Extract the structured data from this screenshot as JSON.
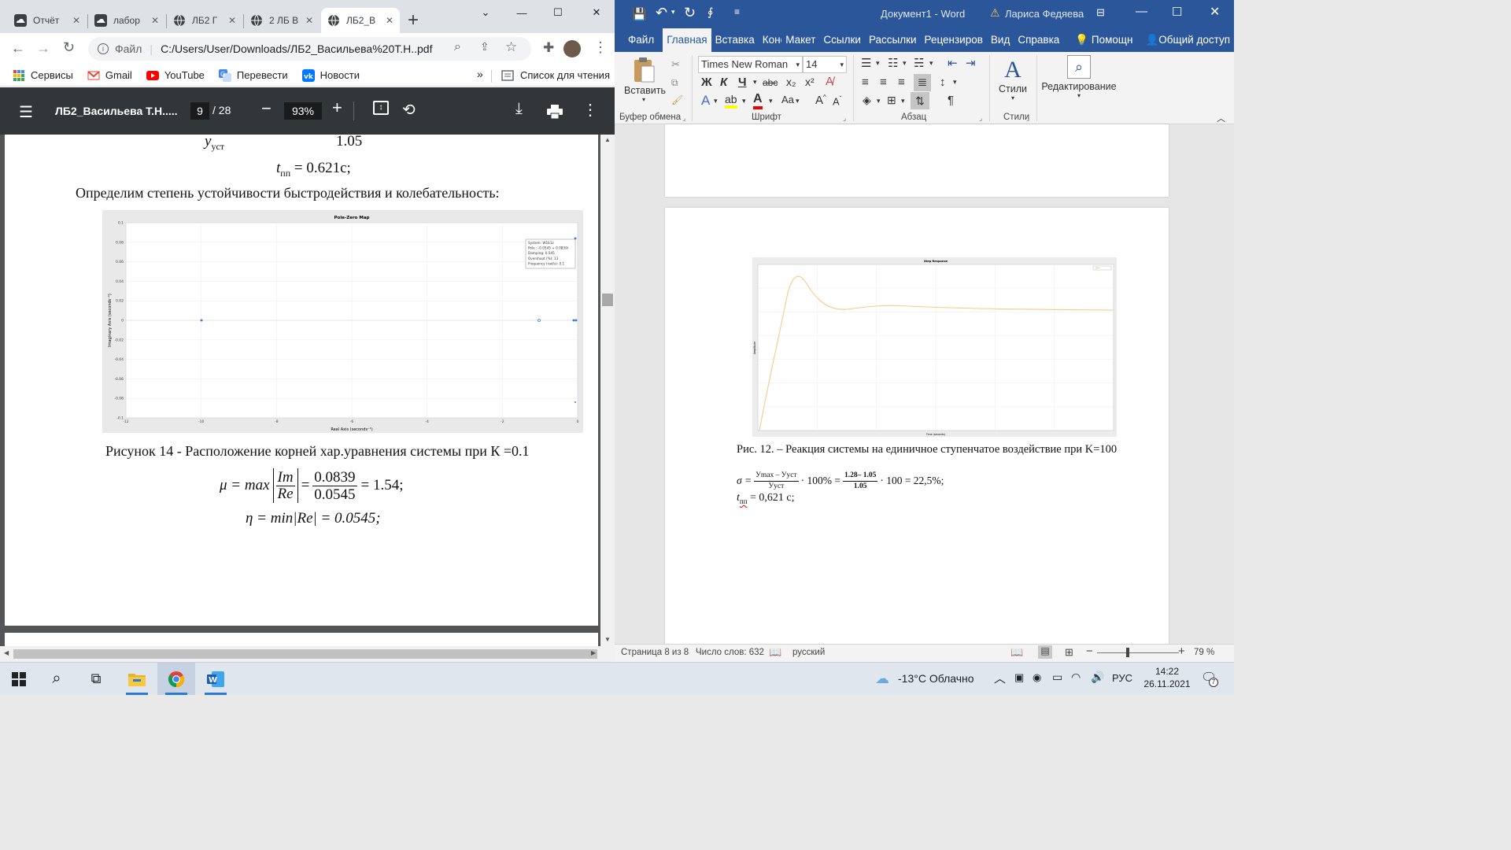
{
  "chrome": {
    "tabs": [
      {
        "label": "Отчёт"
      },
      {
        "label": "лабор"
      },
      {
        "label": "ЛБ2 Г"
      },
      {
        "label": "2 ЛБ В"
      },
      {
        "label": "ЛБ2_В"
      }
    ],
    "new_tab": "+",
    "address": {
      "scheme": "Файл",
      "url": "C:/Users/User/Downloads/ЛБ2_Васильева%20Т.Н..pdf"
    },
    "bookmarks": [
      {
        "label": "Сервисы",
        "icon": "apps-icon"
      },
      {
        "label": "Gmail",
        "icon": "gmail-icon"
      },
      {
        "label": "YouTube",
        "icon": "youtube-icon"
      },
      {
        "label": "Перевести",
        "icon": "translate-icon"
      },
      {
        "label": "Новости",
        "icon": "vk-icon"
      }
    ],
    "bookmarks_more": "»",
    "reading_list": "Список для чтения"
  },
  "pdf": {
    "title": "ЛБ2_Васильева Т.Н.....",
    "page_current": "9",
    "page_total": "/ 28",
    "zoom": "93%",
    "content": {
      "partial_line_sub": "уст",
      "partial_line_y": "y",
      "partial_value": "1.05",
      "t_pp": "= 0.621с;",
      "t_label": "t",
      "t_sub": "пп",
      "paragraph": "Определим степень устойчивости быстродействия и колебательность:",
      "figure_caption": "Рисунок 14 - Расположение корней хар.уравнения системы при К =0.1",
      "mu_lhs": "μ = max",
      "mu_im": "Im",
      "mu_re": "Re",
      "mu_num": "0.0839",
      "mu_den": "0.0545",
      "mu_result": "= 1.54;",
      "eta": "η = min|Re| = 0.0545;"
    }
  },
  "pole_zero_plot": {
    "title": "Pole-Zero Map",
    "xlabel": "Real Axis (seconds⁻¹)",
    "ylabel": "Imaginary Axis (seconds⁻¹)",
    "xticks": [
      "-12",
      "-10",
      "-8",
      "-6",
      "-4",
      "-2",
      "0"
    ],
    "yticks": [
      "0.1",
      "0.08",
      "0.06",
      "0.04",
      "0.02",
      "0",
      "-0.02",
      "-0.04",
      "-0.06",
      "-0.08",
      "-0.1"
    ],
    "tooltip": [
      "System: W1b1z",
      "Pole : -0.0545 + 0.0839i",
      "Damping: 0.545",
      "Overshoot (%): 13",
      "Frequency (rad/s): 0.1"
    ]
  },
  "word": {
    "title": "Документ1 - Word",
    "user": "Лариса Федяева",
    "tabs": [
      "Файл",
      "Главная",
      "Вставка",
      "Конструктор",
      "Макет",
      "Ссылки",
      "Рассылки",
      "Рецензиров",
      "Вид",
      "Справка"
    ],
    "help": "Помощн",
    "share": "Общий доступ",
    "ribbon": {
      "paste": "Вставить",
      "font_name": "Times New Roman",
      "font_size": "14",
      "styles": "Стили",
      "editing": "Редактирование",
      "groups": [
        "Буфер обмена",
        "Шрифт",
        "Абзац",
        "Стили"
      ],
      "bold": "Ж",
      "italic": "К",
      "underline": "Ч",
      "strike": "abc",
      "sub": "x₂",
      "sup": "x²",
      "case": "Aa",
      "grow": "A",
      "shrink": "A"
    },
    "step_plot": {
      "title": "Step Response",
      "xlabel": "Time (seconds)",
      "ylabel": "Amplitude"
    },
    "caption": "Рис. 12. – Реакция системы на единичное ступенчатое воздействие при K=100",
    "sigma": {
      "lhs": "σ =",
      "frac1_num": "Уmax – Ууст",
      "frac1_den": "Ууст",
      "mid": "· 100% =",
      "frac2_num": "1.28– 1.05",
      "frac2_den": "1.05",
      "rhs": "· 100 = 22,5%;"
    },
    "tpp": {
      "t": "t",
      "sub": "пп",
      "rest": "= 0,621 с;"
    },
    "status": {
      "page": "Страница 8 из 8",
      "words": "Число слов: 632",
      "lang": "русский",
      "zoom": "79 %"
    }
  },
  "taskbar": {
    "weather": "-13°C  Облачно",
    "lang": "РУС",
    "time": "14:22",
    "date": "26.11.2021",
    "notif_count": "7"
  }
}
